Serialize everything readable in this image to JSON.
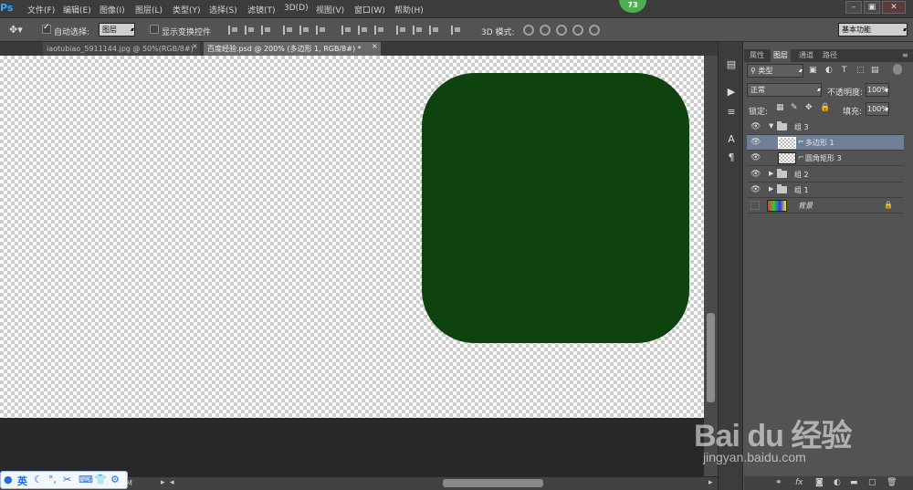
{
  "app": {
    "logo": "Ps",
    "notification_count": "73"
  },
  "menu": [
    {
      "label": "文件(F)"
    },
    {
      "label": "编辑(E)"
    },
    {
      "label": "图像(I)"
    },
    {
      "label": "图层(L)"
    },
    {
      "label": "类型(Y)"
    },
    {
      "label": "选择(S)"
    },
    {
      "label": "滤镜(T)"
    },
    {
      "label": "3D(D)"
    },
    {
      "label": "视图(V)"
    },
    {
      "label": "窗口(W)"
    },
    {
      "label": "帮助(H)"
    }
  ],
  "window_controls": {
    "minimize": "–",
    "restore": "▣",
    "close": "✕"
  },
  "options_bar": {
    "auto_select_label": "自动选择:",
    "auto_select_checked": true,
    "auto_select_target": "图层",
    "show_transform_label": "显示变换控件",
    "show_transform_checked": false,
    "mode_3d_label": "3D 模式:",
    "workspace": "基本功能"
  },
  "tabs": [
    {
      "label": "iaotubiao_5911144.jpg @ 50%(RGB/8#)",
      "close": "×",
      "active": false
    },
    {
      "label": "百度经验.psd @ 200% (多边形 1, RGB/8#) *",
      "close": "×",
      "active": true
    }
  ],
  "canvas": {
    "shape_color": "#0e420e"
  },
  "colors": {
    "foreground": "#0e420e",
    "background": "#ffffff"
  },
  "tools": [
    {
      "name": "marquee-tool",
      "glyph": "⬚"
    },
    {
      "name": "move-tool",
      "glyph": "✥"
    },
    {
      "name": "lasso-tool",
      "glyph": "ℓ"
    },
    {
      "name": "magic-wand-tool",
      "glyph": "✲"
    },
    {
      "name": "crop-tool",
      "glyph": "⌗"
    },
    {
      "name": "eyedropper-tool",
      "glyph": "⁄"
    },
    {
      "name": "healing-tool",
      "glyph": "✚"
    },
    {
      "name": "brush-tool",
      "glyph": "✎"
    },
    {
      "name": "stamp-tool",
      "glyph": "♙"
    },
    {
      "name": "history-brush-tool",
      "glyph": "↶"
    },
    {
      "name": "eraser-tool",
      "glyph": "▱"
    },
    {
      "name": "paint-bucket-tool",
      "glyph": "◆"
    },
    {
      "name": "blur-tool",
      "glyph": "●"
    },
    {
      "name": "dodge-tool",
      "glyph": "◐"
    },
    {
      "name": "pen-tool",
      "glyph": "✒"
    },
    {
      "name": "type-tool",
      "glyph": "T"
    },
    {
      "name": "path-select-tool",
      "glyph": "➤"
    },
    {
      "name": "shape-tool",
      "glyph": "⬢"
    },
    {
      "name": "hand-tool",
      "glyph": "✋"
    },
    {
      "name": "zoom-tool",
      "glyph": "⚲"
    }
  ],
  "status": {
    "doc_info": "M"
  },
  "ime": {
    "lang": "英",
    "items": [
      "☾",
      "°,",
      "✂",
      "⌨",
      "👕",
      "⚙"
    ]
  },
  "panel_tabs": [
    {
      "label": "属性",
      "active": false
    },
    {
      "label": "图层",
      "active": true
    },
    {
      "label": "通道",
      "active": false
    },
    {
      "label": "路径",
      "active": false
    }
  ],
  "layers_panel": {
    "filter_kind": "类型",
    "blend_mode": "正常",
    "opacity_label": "不透明度:",
    "opacity_value": "100%",
    "lock_label": "锁定:",
    "fill_label": "填充:",
    "fill_value": "100%"
  },
  "layers": [
    {
      "name": "组 3",
      "type": "group",
      "expanded": true,
      "visible": true,
      "selected": false,
      "indent": 0
    },
    {
      "name": "多边形 1",
      "type": "shape",
      "visible": true,
      "selected": true,
      "indent": 1
    },
    {
      "name": "圆角矩形 3",
      "type": "shape",
      "visible": true,
      "selected": false,
      "indent": 1
    },
    {
      "name": "组 2",
      "type": "group",
      "expanded": false,
      "visible": true,
      "selected": false,
      "indent": 0
    },
    {
      "name": "组 1",
      "type": "group",
      "expanded": false,
      "visible": true,
      "selected": false,
      "indent": 0
    },
    {
      "name": "背景",
      "type": "background",
      "visible": false,
      "selected": false,
      "locked": true,
      "indent": 0
    }
  ],
  "watermark": {
    "logo": "Bai du 经验",
    "url": "jingyan.baidu.com"
  }
}
